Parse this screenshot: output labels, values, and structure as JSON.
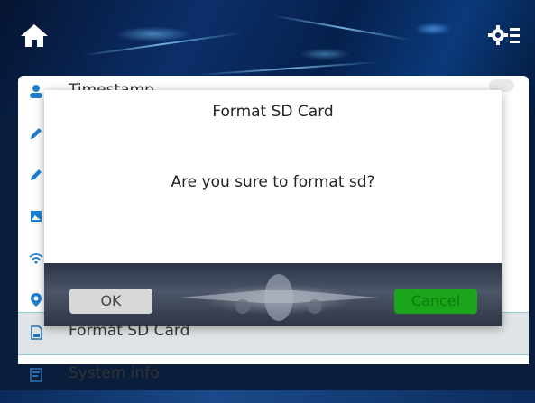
{
  "settings_list": {
    "items": [
      {
        "label": "Timestamp",
        "icon": "person-icon"
      },
      {
        "label": "",
        "icon": "pencil-icon"
      },
      {
        "label": "",
        "icon": "pencil-icon"
      },
      {
        "label": "",
        "icon": "image-icon"
      },
      {
        "label": "",
        "icon": "wifi-icon"
      },
      {
        "label": "",
        "icon": "location-icon"
      },
      {
        "label": "Format SD Card",
        "icon": "sd-card-icon"
      },
      {
        "label": "System info",
        "icon": "info-icon"
      }
    ]
  },
  "dialog": {
    "title": "Format SD Card",
    "message": "Are you sure to format sd?",
    "ok_label": "OK",
    "cancel_label": "Cancel"
  },
  "colors": {
    "accent_blue": "#1e7fd0",
    "ok_button": "#d8d8d8",
    "cancel_button": "#1aa51a",
    "selected_row": "#dfe4e6"
  }
}
